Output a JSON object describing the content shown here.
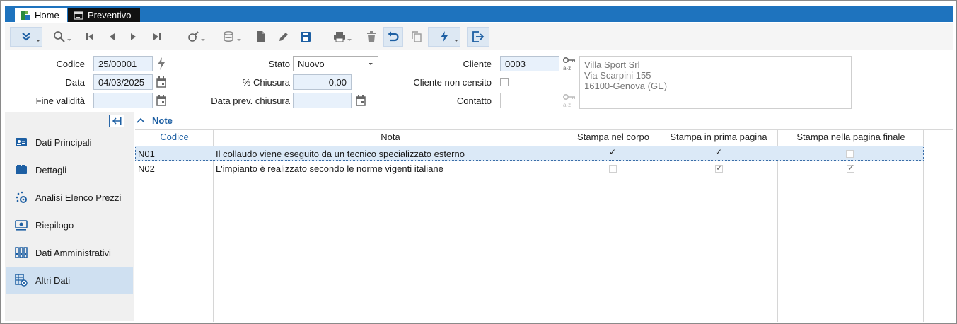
{
  "tabs": [
    {
      "label": "Home"
    },
    {
      "label": "Preventivo"
    }
  ],
  "form": {
    "codice_label": "Codice",
    "codice_value": "25/00001",
    "data_label": "Data",
    "data_value": "04/03/2025",
    "fine_validita_label": "Fine validità",
    "fine_validita_value": "",
    "stato_label": "Stato",
    "stato_value": "Nuovo",
    "chiusura_label": "% Chiusura",
    "chiusura_value": "0,00",
    "data_prev_chiusura_label": "Data prev. chiusura",
    "data_prev_chiusura_value": "",
    "cliente_label": "Cliente",
    "cliente_value": "0003",
    "cliente_non_censito_label": "Cliente non censito",
    "contatto_label": "Contatto",
    "contatto_value": "",
    "address": {
      "line1": "Villa Sport Srl",
      "line2": "Via Scarpini 155",
      "line3": "16100-Genova (GE)"
    }
  },
  "nav": {
    "items": [
      {
        "label": "Dati Principali",
        "icon": "id-card-icon",
        "selected": false
      },
      {
        "label": "Dettagli",
        "icon": "folder-icon",
        "selected": false
      },
      {
        "label": "Analisi Elenco Prezzi",
        "icon": "gear-dots-icon",
        "selected": false
      },
      {
        "label": "Riepilogo",
        "icon": "money-icon",
        "selected": false
      },
      {
        "label": "Dati Amministrativi",
        "icon": "binders-icon",
        "selected": false
      },
      {
        "label": "Altri Dati",
        "icon": "table-add-icon",
        "selected": true
      }
    ]
  },
  "notes": {
    "title": "Note",
    "columns": [
      "Codice",
      "Nota",
      "Stampa nel corpo",
      "Stampa in prima pagina",
      "Stampa nella pagina finale"
    ],
    "rows": [
      {
        "codice": "N01",
        "nota": "Il collaudo viene eseguito da un tecnico specializzato esterno",
        "corpo": true,
        "prima": true,
        "finale": false
      },
      {
        "codice": "N02",
        "nota": "L'impianto è realizzato secondo le norme vigenti italiane",
        "corpo": false,
        "prima": true,
        "finale": true
      }
    ]
  },
  "colors": {
    "accent": "#1e73be",
    "field_bg": "#e8f1fb",
    "selected_row": "#dbe9f7",
    "nav_selected": "#cfe0f1"
  }
}
